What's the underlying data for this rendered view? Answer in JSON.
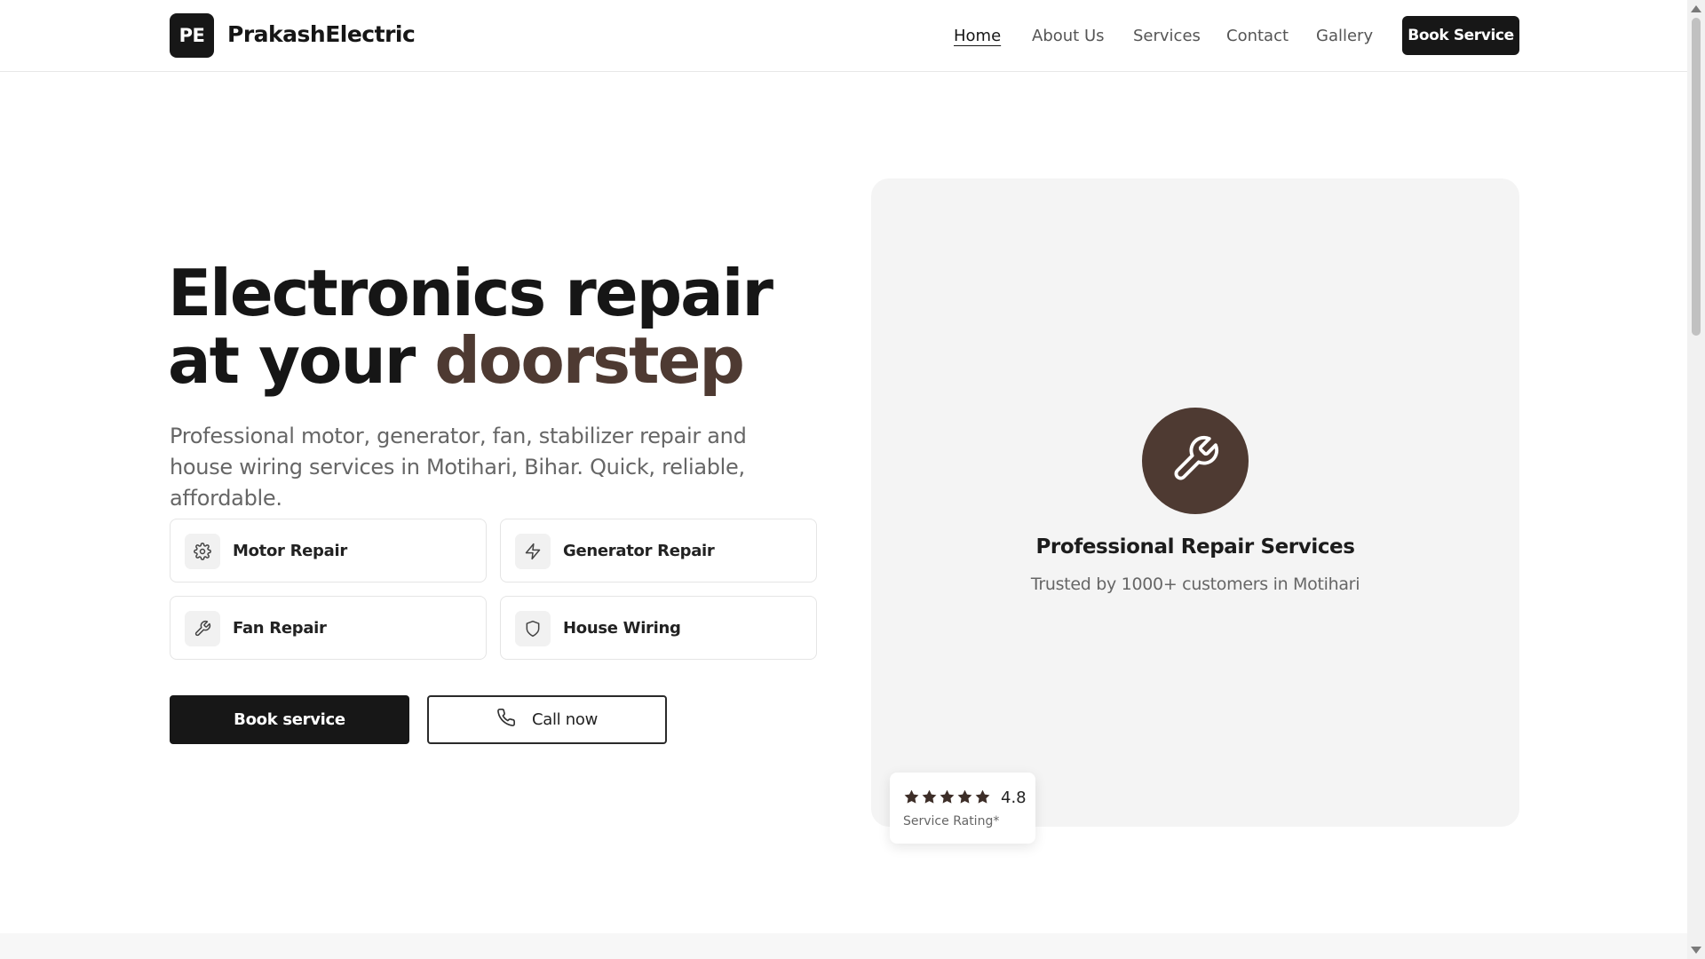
{
  "header": {
    "logo_text": "PE",
    "brand": "PrakashElectric",
    "nav": [
      "Home",
      "About Us",
      "Services",
      "Contact",
      "Gallery"
    ],
    "cta": "Book Service"
  },
  "hero": {
    "title_part1": "Electronics repair at your ",
    "title_accent": "doorstep",
    "subtitle": "Professional motor, generator, fan, stabilizer repair and house wiring services in Motihari, Bihar. Quick, reliable, affordable.",
    "services": [
      {
        "label": "Motor Repair",
        "icon": "gear-icon"
      },
      {
        "label": "Generator Repair",
        "icon": "lightning-icon"
      },
      {
        "label": "Fan Repair",
        "icon": "wrench-icon"
      },
      {
        "label": "House Wiring",
        "icon": "shield-icon"
      }
    ],
    "primary_button": "Book service",
    "secondary_button": "Call now"
  },
  "panel": {
    "icon": "wrench-icon",
    "title": "Professional Repair Services",
    "subtitle": "Trusted by 1000+ customers in Motihari"
  },
  "rating": {
    "value": "4.8",
    "stars": 5,
    "label": "Service Rating*"
  },
  "colors": {
    "accent": "#4e3a32",
    "dark": "#171717"
  }
}
